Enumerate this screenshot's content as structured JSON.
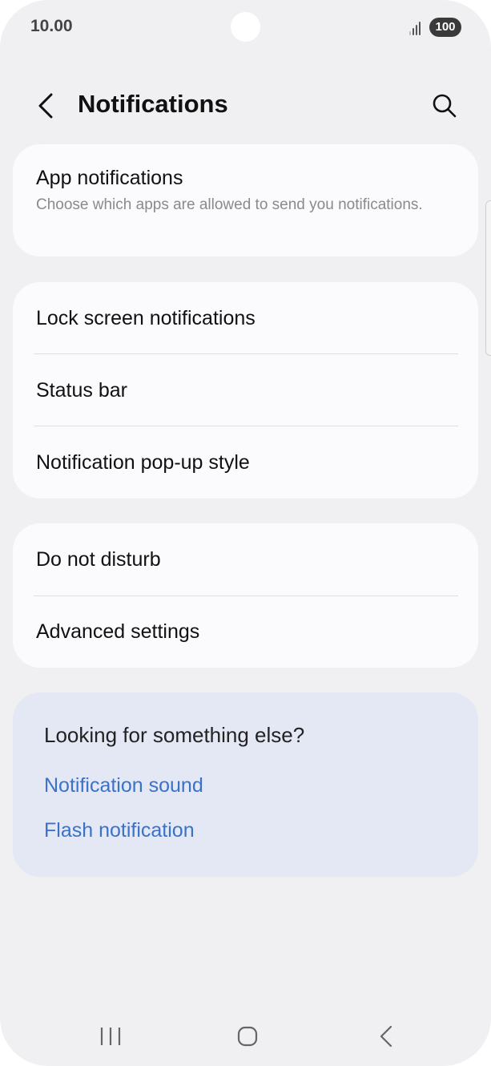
{
  "status_bar": {
    "time": "10.00",
    "battery": "100",
    "icons": [
      "camera-cutout",
      "signal-icon",
      "battery-icon"
    ]
  },
  "header": {
    "title": "Notifications",
    "icons": [
      "back-arrow-icon",
      "search-icon"
    ]
  },
  "app_notifications": {
    "title": "App notifications",
    "subtitle": "Choose which apps are allowed to send you notifications."
  },
  "group_display": {
    "items": [
      {
        "label": "Lock screen notifications"
      },
      {
        "label": "Status bar"
      },
      {
        "label": "Notification pop-up style"
      }
    ]
  },
  "group_advanced": {
    "items": [
      {
        "label": "Do not disturb"
      },
      {
        "label": "Advanced settings"
      }
    ]
  },
  "suggestions": {
    "title": "Looking for something else?",
    "links": [
      {
        "label": "Notification sound"
      },
      {
        "label": "Flash notification"
      }
    ]
  },
  "nav_bar": {
    "icons": [
      "recents-icon",
      "home-icon",
      "back-icon"
    ]
  },
  "colors": {
    "background": "#f0f0f2",
    "card": "#fbfbfd",
    "suggestion_card": "#e4e8f4",
    "link": "#3a72c9",
    "subtitle": "#8a8a8a"
  }
}
